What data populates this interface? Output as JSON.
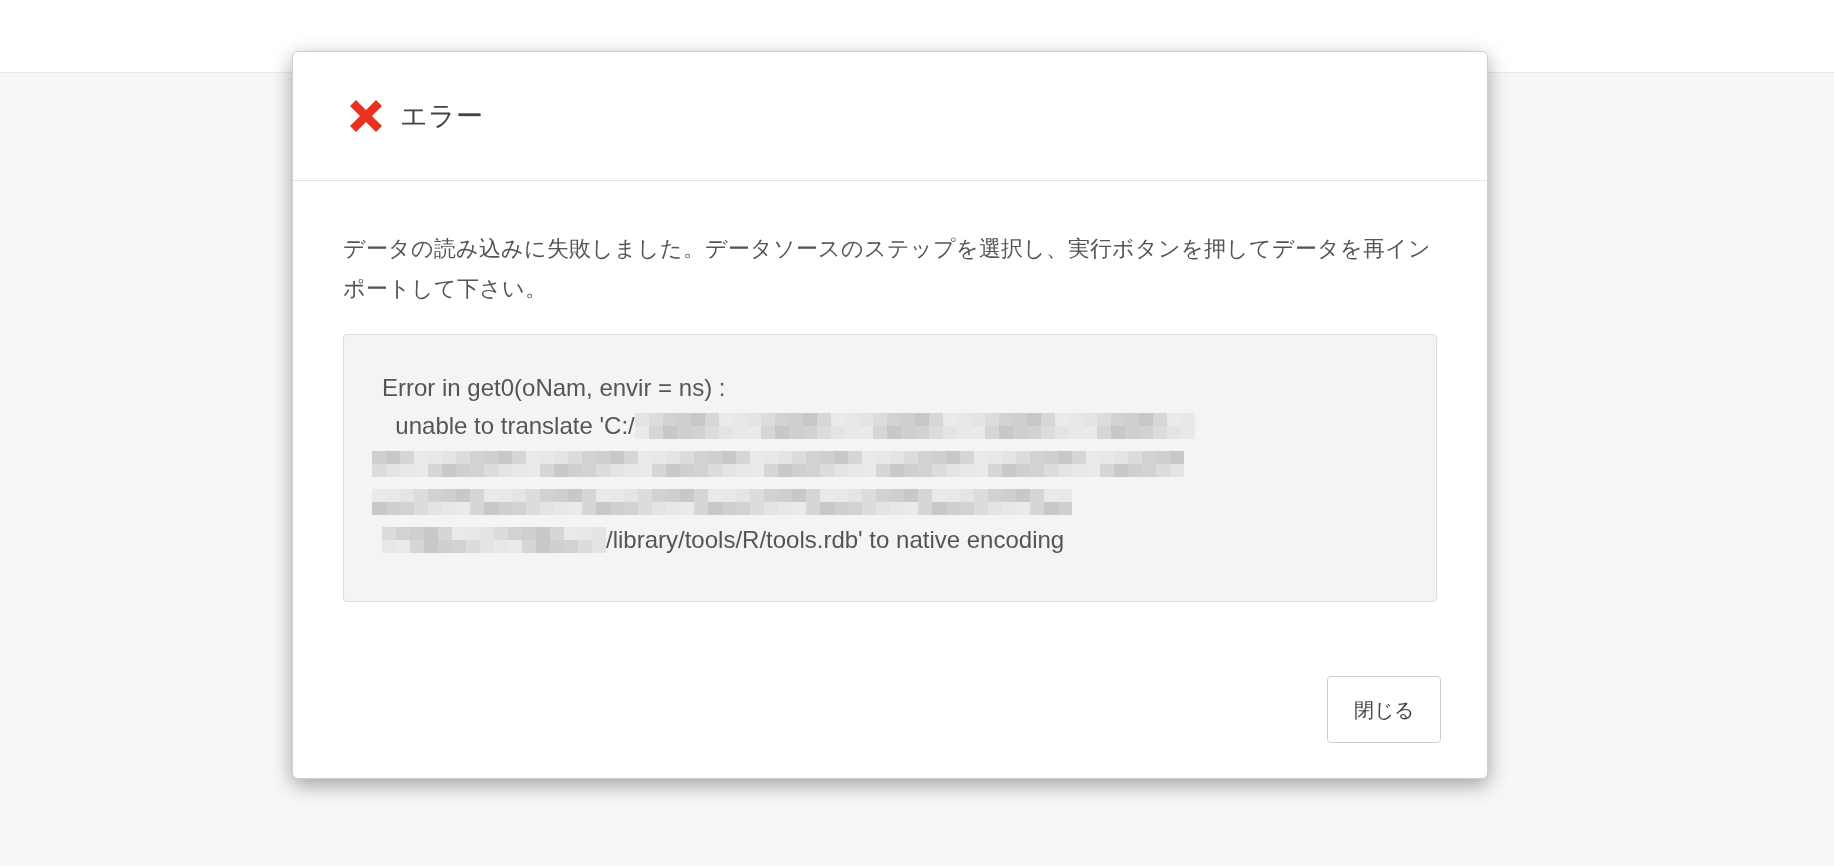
{
  "dialog": {
    "title": "エラー",
    "message": "データの読み込みに失敗しました。データソースのステップを選択し、実行ボタンを押してデータを再インポートして下さい。",
    "error_lines": [
      {
        "kind": "text",
        "text": "Error in get0(oNam, envir = ns) :"
      },
      {
        "kind": "text_then_redacted",
        "text": "  unable to translate 'C:/"
      },
      {
        "kind": "redacted"
      },
      {
        "kind": "redacted"
      },
      {
        "kind": "redacted_then_text",
        "text": "/library/tools/R/tools.rdb' to native encoding"
      }
    ],
    "buttons": [
      "閉じる"
    ]
  }
}
